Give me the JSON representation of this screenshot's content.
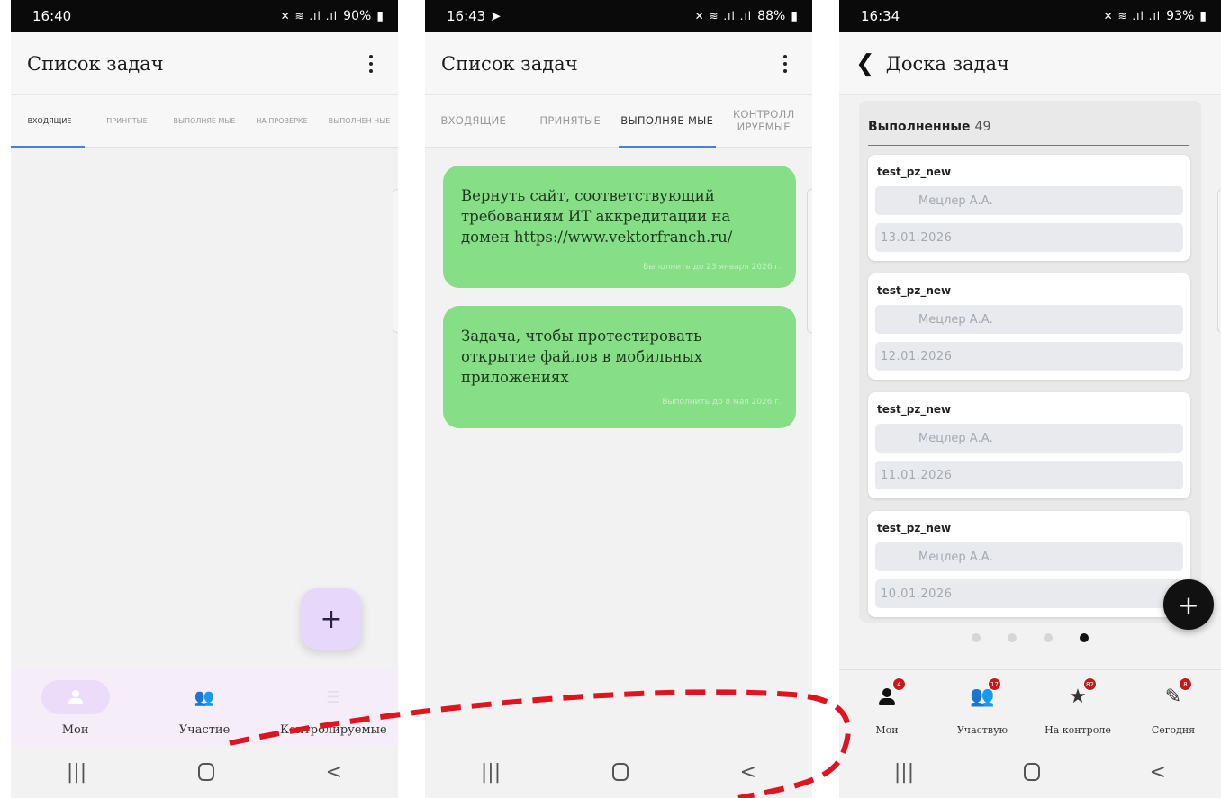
{
  "screen1": {
    "status": {
      "time": "16:40",
      "battery": "90%"
    },
    "title": "Список задач",
    "tabs": [
      "ВХОДЯЩИЕ",
      "ПРИНЯТЫЕ",
      "ВЫПОЛНЯЕ МЫЕ",
      "НА ПРОВЕРКЕ",
      "ВЫПОЛНЕН НЫЕ"
    ],
    "active_tab": 0,
    "fab_label": "+",
    "nav": [
      {
        "label": "Мои",
        "icon": "person-icon",
        "active": true
      },
      {
        "label": "Участие",
        "icon": "group-icon",
        "active": false
      },
      {
        "label": "Контролируемые",
        "icon": "checklist-icon",
        "active": false
      }
    ]
  },
  "screen2": {
    "status": {
      "time": "16:43",
      "battery": "88%"
    },
    "title": "Список задач",
    "tabs": [
      "ВХОДЯЩИЕ",
      "ПРИНЯТЫЕ",
      "ВЫПОЛНЯЕ МЫЕ",
      "КОНТРОЛЛ ИРУЕМЫЕ"
    ],
    "active_tab": 2,
    "cards": [
      {
        "text": "Вернуть сайт, соответствующий требованиям ИТ аккредитации на домен https://www.vektorfranch.ru/",
        "due": "Выполнить до 23 января 2026 г."
      },
      {
        "text": "Задача, чтобы протестировать открытие файлов в мобильных приложениях",
        "due": "Выполнить до 8 мая 2026 г."
      }
    ]
  },
  "screen3": {
    "status": {
      "time": "16:34",
      "battery": "93%"
    },
    "title": "Доска задач",
    "column": {
      "name": "Выполненные",
      "count": "49"
    },
    "tasks": [
      {
        "name": "test_pz_new",
        "assignee": "Мецлер А.А.",
        "date": "13.01.2026"
      },
      {
        "name": "test_pz_new",
        "assignee": "Мецлер А.А.",
        "date": "12.01.2026"
      },
      {
        "name": "test_pz_new",
        "assignee": "Мецлер А.А.",
        "date": "11.01.2026"
      },
      {
        "name": "test_pz_new",
        "assignee": "Мецлер А.А.",
        "date": "10.01.2026"
      }
    ],
    "page_dots": {
      "count": 4,
      "active": 3
    },
    "fab_label": "+",
    "nav": [
      {
        "label": "Мои",
        "badge": "4",
        "icon": "person-icon"
      },
      {
        "label": "Участвую",
        "badge": "17",
        "icon": "group-icon"
      },
      {
        "label": "На контроле",
        "badge": "82",
        "icon": "star-icon"
      },
      {
        "label": "Сегодня",
        "badge": "8",
        "icon": "edit-icon"
      }
    ]
  },
  "sysnav": {
    "recents": "|||",
    "back": "<"
  },
  "colors": {
    "card_green": "#86de86",
    "fab_purple": "#e6d8fb",
    "annotation_red": "#e0141e",
    "tab_indicator": "#4a7fd4"
  }
}
